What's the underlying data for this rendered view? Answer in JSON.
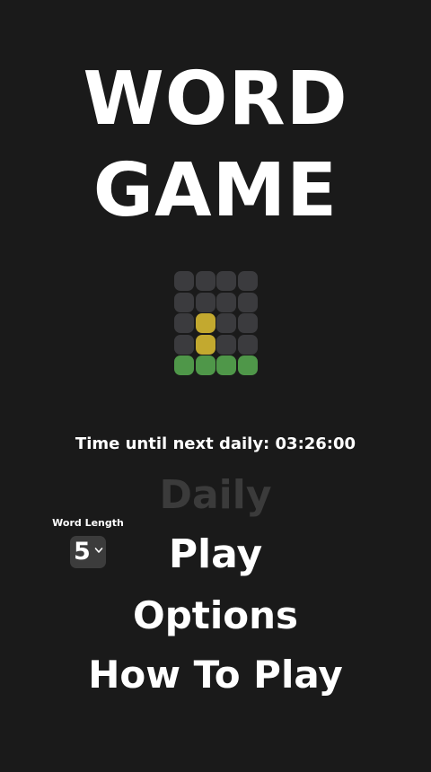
{
  "title": {
    "line1": "WORD",
    "line2": "GAME"
  },
  "logo": {
    "rows": [
      [
        "empty",
        "empty",
        "empty",
        "empty"
      ],
      [
        "empty",
        "empty",
        "empty",
        "empty"
      ],
      [
        "empty",
        "present",
        "empty",
        "empty"
      ],
      [
        "empty",
        "present",
        "empty",
        "empty"
      ],
      [
        "correct",
        "correct",
        "correct",
        "correct"
      ]
    ],
    "colors": {
      "empty": "#3b3b3e",
      "present": "#c3a92f",
      "correct": "#4f9749"
    }
  },
  "timer": {
    "text": "Time until next daily: 03:26:00"
  },
  "word_length": {
    "label": "Word Length",
    "value": "5",
    "icon": "chevron-down-icon"
  },
  "menu": {
    "daily": "Daily",
    "daily_state": "disabled",
    "play": "Play",
    "options": "Options",
    "how_to_play": "How To Play"
  },
  "colors": {
    "background": "#1a1a1a",
    "text": "#ffffff",
    "disabled_text": "#3b3b3b",
    "select_bg": "#3c3c3c"
  }
}
